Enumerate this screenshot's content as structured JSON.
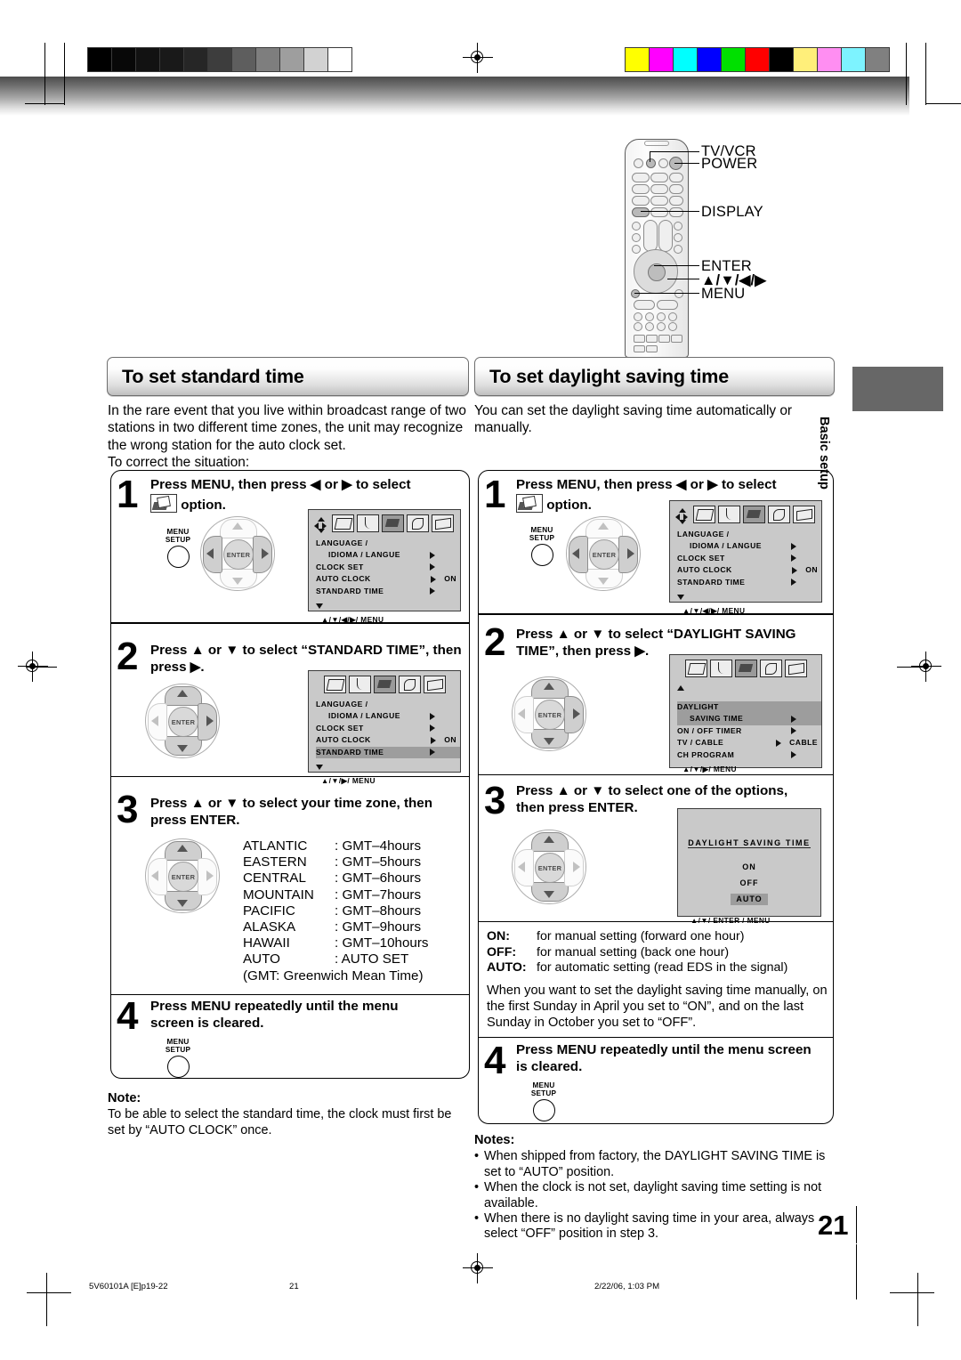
{
  "print_marks": {
    "grayscale_swatches": [
      "#000000",
      "#080808",
      "#121212",
      "#191919",
      "#262626",
      "#3d3d3d",
      "#5e5e5e",
      "#7e7e7e",
      "#9e9e9e",
      "#d2d2d2",
      "#ffffff"
    ],
    "color_swatches": [
      "#ffff00",
      "#ff00ff",
      "#00ffff",
      "#0000ff",
      "#00e000",
      "#ff0000",
      "#000000",
      "#ffef7a",
      "#ff8ef2",
      "#7df3ff",
      "#808080"
    ]
  },
  "remote": {
    "callouts": [
      "TV/VCR",
      "POWER",
      "DISPLAY",
      "ENTER",
      "▲/▼/◀/▶",
      "MENU"
    ],
    "enter_label": "ENTER"
  },
  "side_tab": {
    "label": "Basic setup"
  },
  "left": {
    "title": "To set standard time",
    "intro": "In the rare event that you live within broadcast range of two stations in two different time zones, the unit may recognize the wrong station for the auto clock set.\nTo correct the situation:",
    "steps": [
      {
        "no": "1",
        "line1": "Press MENU, then press ◀ or ▶ to select",
        "line2_after_icon": "option."
      },
      {
        "no": "2",
        "line1": "Press ▲ or ▼ to select “STANDARD TIME”, then",
        "line2": "press ▶."
      },
      {
        "no": "3",
        "line1": "Press ▲ or ▼ to select your time zone, then",
        "line2": "press ENTER."
      },
      {
        "no": "4",
        "line1": "Press MENU repeatedly until the menu",
        "line2": "screen is cleared."
      }
    ],
    "menu_button": {
      "line1": "MENU",
      "line2": "SETUP"
    },
    "osd1": {
      "rows": [
        {
          "label": "LANGUAGE /",
          "value": "",
          "arrow": false
        },
        {
          "label": "IDIOMA / LANGUE",
          "value": "",
          "arrow": true,
          "indent": true
        },
        {
          "label": "CLOCK SET",
          "value": "",
          "arrow": true
        },
        {
          "label": "AUTO CLOCK",
          "value": "ON",
          "arrow": true
        },
        {
          "label": "STANDARD TIME",
          "value": "",
          "arrow": true
        }
      ],
      "footer": "▲/▼/◀/▶/ MENU"
    },
    "osd2": {
      "rows": [
        {
          "label": "LANGUAGE /",
          "value": "",
          "arrow": false
        },
        {
          "label": "IDIOMA / LANGUE",
          "value": "",
          "arrow": true,
          "indent": true
        },
        {
          "label": "CLOCK SET",
          "value": "",
          "arrow": true
        },
        {
          "label": "AUTO CLOCK",
          "value": "ON",
          "arrow": true
        },
        {
          "label": "STANDARD TIME",
          "value": "",
          "arrow": true,
          "highlight": true
        }
      ],
      "footer": "▲/▼/▶/ MENU"
    },
    "timezones": [
      {
        "zone": "ATLANTIC",
        "offset": ": GMT–4hours"
      },
      {
        "zone": "EASTERN",
        "offset": ": GMT–5hours"
      },
      {
        "zone": "CENTRAL",
        "offset": ": GMT–6hours"
      },
      {
        "zone": "MOUNTAIN",
        "offset": ": GMT–7hours"
      },
      {
        "zone": "PACIFIC",
        "offset": ": GMT–8hours"
      },
      {
        "zone": "ALASKA",
        "offset": ": GMT–9hours"
      },
      {
        "zone": "HAWAII",
        "offset": ": GMT–10hours"
      },
      {
        "zone": "AUTO",
        "offset": ": AUTO SET"
      }
    ],
    "gmt_note": "(GMT: Greenwich Mean Time)",
    "note_heading": "Note:",
    "note_body": "To be able to select the standard time, the clock must first be set by “AUTO CLOCK” once."
  },
  "right": {
    "title": "To set daylight saving time",
    "intro": "You can set the daylight saving time automatically or manually.",
    "steps": [
      {
        "no": "1",
        "line1": "Press MENU, then press ◀ or ▶ to select",
        "line2_after_icon": "option."
      },
      {
        "no": "2",
        "line1": "Press ▲ or ▼ to select “DAYLIGHT SAVING",
        "line2": "TIME”, then press ▶."
      },
      {
        "no": "3",
        "line1": "Press ▲ or ▼ to select one of the options,",
        "line2": "then press ENTER."
      },
      {
        "no": "4",
        "line1": "Press MENU repeatedly until the menu screen",
        "line2": "is cleared."
      }
    ],
    "menu_button": {
      "line1": "MENU",
      "line2": "SETUP"
    },
    "osd1": {
      "rows": [
        {
          "label": "LANGUAGE /",
          "value": "",
          "arrow": false
        },
        {
          "label": "IDIOMA / LANGUE",
          "value": "",
          "arrow": true,
          "indent": true
        },
        {
          "label": "CLOCK SET",
          "value": "",
          "arrow": true
        },
        {
          "label": "AUTO CLOCK",
          "value": "ON",
          "arrow": true
        },
        {
          "label": "STANDARD TIME",
          "value": "",
          "arrow": true
        }
      ],
      "footer": "▲/▼/◀/▶/ MENU"
    },
    "osd2": {
      "rows": [
        {
          "label": "DAYLIGHT",
          "value": "",
          "arrow": false,
          "highlight": true
        },
        {
          "label": "SAVING TIME",
          "value": "",
          "arrow": true,
          "indent": true,
          "highlight": true
        },
        {
          "label": "ON / OFF TIMER",
          "value": "",
          "arrow": true
        },
        {
          "label": "TV / CABLE",
          "value": "CABLE",
          "arrow": true
        },
        {
          "label": "CH PROGRAM",
          "value": "",
          "arrow": true
        }
      ],
      "footer": "▲/▼/▶/ MENU"
    },
    "osd3": {
      "title": "DAYLIGHT  SAVING  TIME",
      "options": [
        "ON",
        "OFF",
        "AUTO"
      ],
      "selected": "AUTO",
      "footer": "▲/▼/ ENTER / MENU"
    },
    "option_defs": [
      {
        "key": "ON:",
        "desc": "for manual setting (forward one hour)"
      },
      {
        "key": "OFF:",
        "desc": "for manual setting (back one hour)"
      },
      {
        "key": "AUTO:",
        "desc": "for automatic setting (read EDS in the signal)"
      }
    ],
    "manual_para": "When you want to set the daylight saving time manually, on the first Sunday in April you set to “ON”, and on the last Sunday in October you set to “OFF”.",
    "notes_heading": "Notes:",
    "notes": [
      "When shipped from factory, the DAYLIGHT SAVING TIME is set to “AUTO” position.",
      "When the clock is not set, daylight saving time setting is not available.",
      "When there is no daylight saving time in your area, always select “OFF” position in step 3."
    ]
  },
  "page_number": "21",
  "footer": {
    "file": "5V60101A [E]p19-22",
    "page": "21",
    "timestamp": "2/22/06, 1:03 PM"
  }
}
